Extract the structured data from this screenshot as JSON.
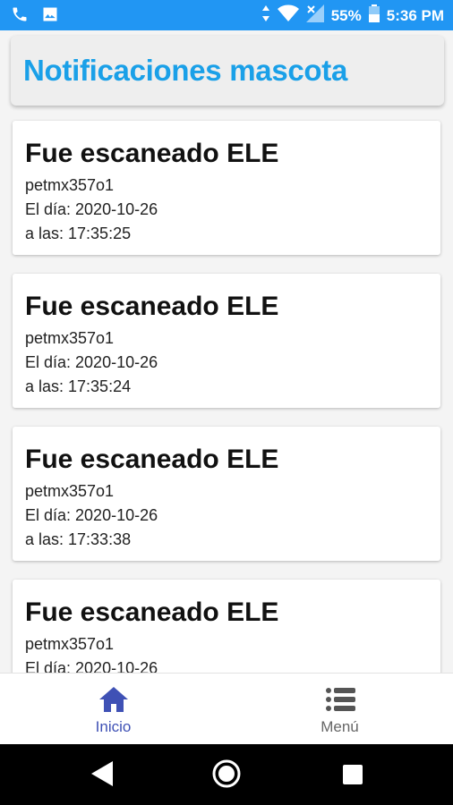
{
  "status_bar": {
    "battery": "55%",
    "time": "5:36 PM",
    "icons": [
      "phone-icon",
      "image-icon",
      "data-arrows-icon",
      "wifi-icon",
      "signal-off-icon",
      "battery-icon"
    ]
  },
  "header": {
    "title": "Notificaciones mascota"
  },
  "notifications": [
    {
      "title": "Fue escaneado ELE",
      "code": "petmx357o1",
      "date": "El día: 2020-10-26",
      "time": "a las: 17:35:25"
    },
    {
      "title": "Fue escaneado ELE",
      "code": "petmx357o1",
      "date": "El día: 2020-10-26",
      "time": "a las: 17:35:24"
    },
    {
      "title": "Fue escaneado ELE",
      "code": "petmx357o1",
      "date": "El día: 2020-10-26",
      "time": "a las: 17:33:38"
    },
    {
      "title": "Fue escaneado ELE",
      "code": "petmx357o1",
      "date": "El día: 2020-10-26",
      "time": ""
    }
  ],
  "tabs": [
    {
      "label": "Inicio",
      "icon": "home-icon",
      "active": true
    },
    {
      "label": "Menú",
      "icon": "list-icon",
      "active": false
    }
  ],
  "colors": {
    "status_bar": "#2196f3",
    "header_title": "#1aa0e8",
    "tab_active": "#3f51b5",
    "tab_inactive": "#666666"
  },
  "nav_icons": [
    "back-icon",
    "home-circle-icon",
    "recents-icon"
  ]
}
